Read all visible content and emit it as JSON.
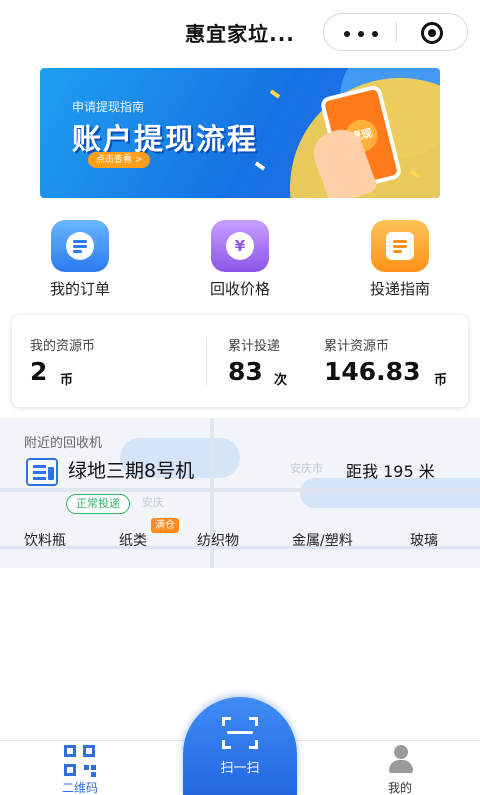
{
  "header": {
    "title": "惠宜家垃...",
    "icons": {
      "more": "more-dots-icon",
      "close": "target-circle-icon"
    }
  },
  "banner": {
    "subtitle": "申请提现指南",
    "headline": "账户提现流程",
    "button": "点击查看 >",
    "phone_label": "提现"
  },
  "quick_menu": [
    {
      "label": "我的订单",
      "icon": "order-icon",
      "color": "#2b7af0"
    },
    {
      "label": "回收价格",
      "icon": "price-icon",
      "glyph": "¥",
      "color": "#8b55e8"
    },
    {
      "label": "投递指南",
      "icon": "guide-icon",
      "color": "#ff9318"
    }
  ],
  "resources": {
    "my_coins_label": "我的资源币",
    "my_coins_value": "2",
    "my_coins_unit": "币",
    "delivery_label": "累计投递",
    "delivery_value": "83",
    "delivery_unit": "次",
    "total_coins_label": "累计资源币",
    "total_coins_value": "146.83",
    "total_coins_unit": "币"
  },
  "nearby": {
    "title": "附近的回收机",
    "machine_name": "绿地三期8号机",
    "distance": "距我 195 米",
    "status": "正常投递",
    "categories": [
      "饮料瓶",
      "纸类",
      "纺织物",
      "金属/塑料",
      "玻璃"
    ],
    "full_badge": "满仓",
    "map_labels": {
      "city": "安庆",
      "city_alt": "安庆市"
    }
  },
  "tabbar": {
    "qr_label": "二维码",
    "scan_label": "扫一扫",
    "mine_label": "我的",
    "active_color": "#2d6fe0"
  }
}
